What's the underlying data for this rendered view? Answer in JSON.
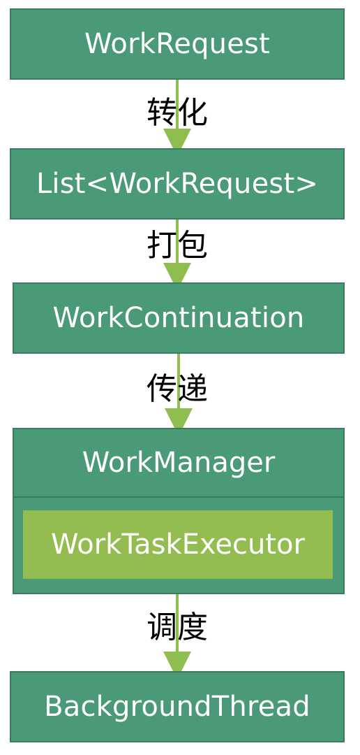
{
  "nodes": {
    "work_request": "WorkRequest",
    "list_work_request": "List<WorkRequest>",
    "work_continuation": "WorkContinuation",
    "work_manager": "WorkManager",
    "work_task_executor": "WorkTaskExecutor",
    "background_thread": "BackgroundThread"
  },
  "edges": {
    "convert": "转化",
    "pack": "打包",
    "pass": "传递",
    "schedule": "调度"
  },
  "colors": {
    "node_fill": "#4a9a78",
    "node_border": "#3a7a5f",
    "inner_fill": "#93bd51",
    "arrow": "#8fbd4f",
    "label_text": "#000000",
    "node_text": "#ffffff"
  }
}
